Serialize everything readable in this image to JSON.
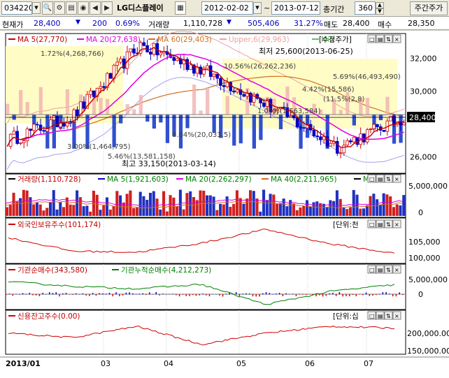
{
  "toolbar": {
    "code": "034220",
    "name": "LG디스플레이",
    "date_from": "2012-02-02",
    "date_to": "2013-07-12",
    "count_label": "총기간",
    "count_value": "360",
    "button_label": "주간주가"
  },
  "quote": {
    "price_label": "현재가",
    "price": "28,400",
    "change": "200",
    "change_pct": "0.69%",
    "volume_label": "거래량",
    "volume": "1,110,728",
    "prev_volume": "505,406",
    "turnover_pct": "31.27%",
    "ask_label": "매도",
    "ask": "28,400",
    "bid_label": "매수",
    "bid": "28,350"
  },
  "panels": {
    "price": {
      "legend": [
        "MA 5(27,770)",
        "MA 20(27,638)",
        "MA 60(29,403)",
        "Upper,6(29,963)",
        "Mid"
      ],
      "legend_colors": [
        "#c00000",
        "#e000e0",
        "#d07020",
        "#f0a0a0",
        "#60c060"
      ],
      "tag": "수정주가",
      "low_annotation": "최저 25,600(2013-06-25)",
      "high_annotation": "최고 33,150(2013-03-14)",
      "current_price_tag": "28,400",
      "pct_labels": [
        "1.72%(4,268,766)",
        "10.56%(26,262,236)",
        "5.69%(46,493,490)",
        "4.42%(15,586)",
        "(11.5%(2,8)",
        "8.04%(20,033,5)",
        "3.00%(1,464,795)",
        "5.46%(13,581,158)",
        "1.05%(1,563,584)"
      ],
      "y_ticks": [
        "32,000",
        "30,000",
        "28,000",
        "26,000"
      ]
    },
    "volume": {
      "legend": [
        "거래량(1,110,728)",
        "MA 5(1,921,603)",
        "MA 20(2,262,297)",
        "MA 40(2,211,965)",
        "MA"
      ],
      "legend_colors": [
        "#000000",
        "#0000c0",
        "#e000e0",
        "#d07020",
        "#000000"
      ],
      "y_ticks": [
        "5,000,000",
        "0"
      ]
    },
    "foreign": {
      "legend": [
        "외국인보유주수(101,174)"
      ],
      "legend_colors": [
        "#d00000"
      ],
      "tag": "[단위:천",
      "y_ticks": [
        "105,000",
        "100,000"
      ]
    },
    "inst": {
      "legend": [
        "기관순매수(343,580)",
        "기관누적순매수(4,212,273)"
      ],
      "legend_colors": [
        "#d00000",
        "#008000"
      ],
      "y_ticks": [
        "5,000,000",
        "0"
      ]
    },
    "credit": {
      "legend": [
        "신용잔고주수(0.00)"
      ],
      "legend_colors": [
        "#d00000"
      ],
      "tag": "[단위:십",
      "y_ticks": [
        "200,000.00",
        "150,000.00"
      ]
    }
  },
  "x_ticks": [
    "2013/01",
    "03",
    "04",
    "05",
    "06",
    "07"
  ],
  "chart_data": [
    {
      "type": "line",
      "name": "수정주가",
      "x": [
        "2013-01",
        "2013-02",
        "2013-03",
        "2013-04",
        "2013-05",
        "2013-06",
        "2013-07"
      ],
      "series": [
        {
          "name": "MA 5",
          "values": [
            27100,
            29400,
            32400,
            30900,
            29400,
            27000,
            27770
          ]
        },
        {
          "name": "MA 20",
          "values": [
            27200,
            28600,
            31700,
            31000,
            29800,
            28200,
            27638
          ]
        },
        {
          "name": "MA 60",
          "values": [
            30400,
            29800,
            30000,
            30500,
            30100,
            29700,
            29403
          ]
        }
      ],
      "ylim": [
        25000,
        33500
      ],
      "low": 25600,
      "high": 33150
    },
    {
      "type": "bar",
      "name": "거래량",
      "categories": [
        "2013-01",
        "2013-02",
        "2013-03",
        "2013-04",
        "2013-05",
        "2013-06",
        "2013-07"
      ],
      "values": [
        2300000,
        2100000,
        2600000,
        2000000,
        1800000,
        2900000,
        1110728
      ],
      "ylim": [
        0,
        6000000
      ]
    },
    {
      "type": "line",
      "name": "외국인보유주수",
      "x": [
        "2013-01",
        "2013-02",
        "2013-03",
        "2013-04",
        "2013-05",
        "2013-06",
        "2013-07"
      ],
      "values": [
        105500,
        101800,
        101500,
        104000,
        107800,
        103800,
        101174
      ],
      "ylim": [
        99000,
        109000
      ]
    },
    {
      "type": "line",
      "name": "기관누적순매수",
      "x": [
        "2013-01",
        "2013-02",
        "2013-03",
        "2013-04",
        "2013-05",
        "2013-06",
        "2013-07"
      ],
      "values": [
        5000000,
        3800000,
        3200000,
        4300000,
        -900000,
        2500000,
        4212273
      ],
      "ylim": [
        -2000000,
        7000000
      ]
    },
    {
      "type": "line",
      "name": "신용잔고주수",
      "x": [
        "2013-01",
        "2013-02",
        "2013-03",
        "2013-04",
        "2013-05",
        "2013-06",
        "2013-07"
      ],
      "values": [
        185000,
        175000,
        200000,
        160000,
        185000,
        200000,
        196000
      ],
      "ylim": [
        140000,
        220000
      ]
    }
  ]
}
